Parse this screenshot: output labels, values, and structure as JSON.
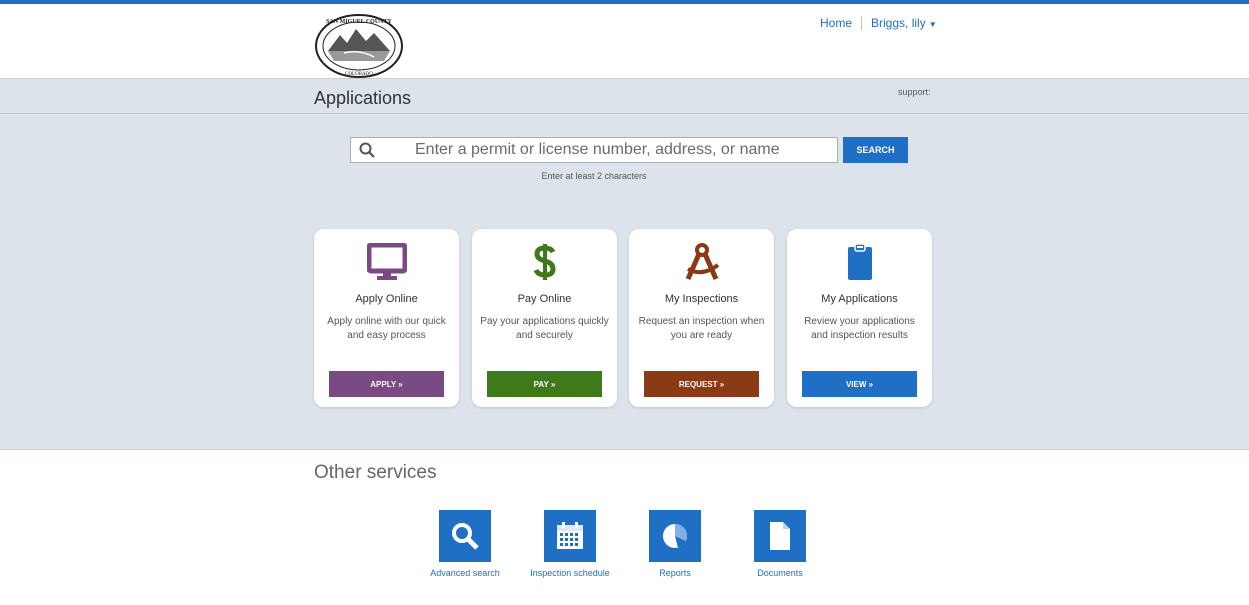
{
  "header": {
    "logo_text_top": "SAN MIGUEL COUNTY",
    "logo_text_bottom": "COLORADO",
    "nav_home": "Home",
    "nav_user": "Briggs, lily"
  },
  "apps_bar": {
    "title": "Applications",
    "support": "support:"
  },
  "search": {
    "placeholder": "Enter a permit or license number, address, or name",
    "button": "SEARCH",
    "hint": "Enter at least 2 characters"
  },
  "cards": [
    {
      "title": "Apply Online",
      "desc": "Apply online with our quick and easy process",
      "button": "APPLY »",
      "color": "#7a4a83",
      "icon": "monitor-icon"
    },
    {
      "title": "Pay Online",
      "desc": "Pay your applications quickly and securely",
      "button": "PAY »",
      "color": "#3f7a1a",
      "icon": "dollar-icon"
    },
    {
      "title": "My Inspections",
      "desc": "Request an inspection when you are ready",
      "button": "REQUEST »",
      "color": "#8a3a14",
      "icon": "compass-icon"
    },
    {
      "title": "My Applications",
      "desc": "Review your applications and inspection results",
      "button": "VIEW »",
      "color": "#1f6fc5",
      "icon": "clipboard-icon"
    }
  ],
  "other": {
    "title": "Other services",
    "services": [
      {
        "label": "Advanced search",
        "icon": "magnifier-icon"
      },
      {
        "label": "Inspection schedule",
        "icon": "calendar-icon"
      },
      {
        "label": "Reports",
        "icon": "pie-chart-icon"
      },
      {
        "label": "Documents",
        "icon": "document-icon"
      }
    ]
  }
}
